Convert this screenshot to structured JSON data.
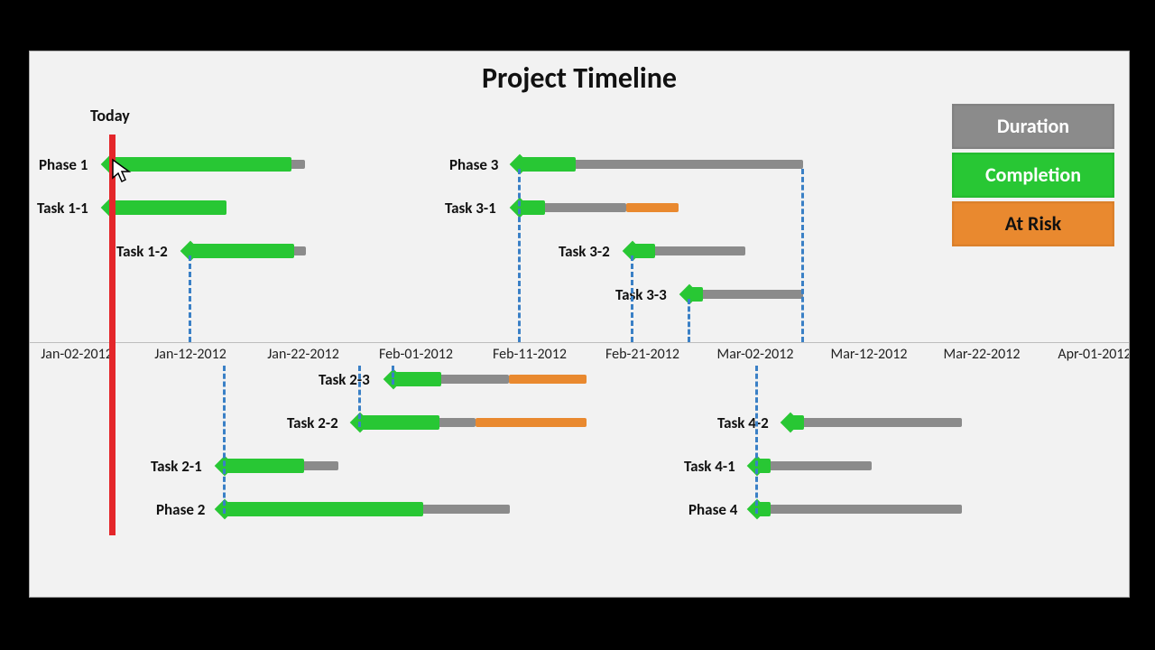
{
  "title": "Project Timeline",
  "today_label": "Today",
  "legend": {
    "duration": "Duration",
    "completion": "Completion",
    "atrisk": "At Risk"
  },
  "colors": {
    "duration": "#8b8b8b",
    "completion": "#28c734",
    "atrisk": "#e9892f",
    "today_line": "#e4262a"
  },
  "axis": {
    "start": "Jan-02-2012",
    "end": "Apr-01-2012",
    "ticks": [
      "Jan-02-2012",
      "Jan-12-2012",
      "Jan-22-2012",
      "Feb-01-2012",
      "Feb-11-2012",
      "Feb-21-2012",
      "Mar-02-2012",
      "Mar-12-2012",
      "Mar-22-2012",
      "Apr-01-2012"
    ]
  },
  "tasks": {
    "phase1": "Phase 1",
    "task11": "Task 1-1",
    "task12": "Task 1-2",
    "phase3": "Phase 3",
    "task31": "Task 3-1",
    "task32": "Task 3-2",
    "task33": "Task 3-3",
    "phase2": "Phase 2",
    "task21": "Task 2-1",
    "task22": "Task 2-2",
    "task23": "Task 2-3",
    "phase4": "Phase 4",
    "task41": "Task 4-1",
    "task42": "Task 4-2"
  },
  "chart_data": {
    "type": "bar",
    "title": "Project Timeline",
    "xlabel": "",
    "ylabel": "",
    "today": "Jan-03-2012",
    "x_range": [
      "Jan-02-2012",
      "Apr-01-2012"
    ],
    "series": [
      {
        "name": "Phase 1",
        "lane": "above",
        "start": "Jan-03-2012",
        "end": "Jan-20-2012",
        "completion_end": "Jan-19-2012",
        "at_risk": false
      },
      {
        "name": "Task 1-1",
        "lane": "above",
        "start": "Jan-03-2012",
        "end": "Jan-13-2012",
        "completion_end": "Jan-13-2012",
        "at_risk": false
      },
      {
        "name": "Task 1-2",
        "lane": "above",
        "start": "Jan-10-2012",
        "end": "Jan-20-2012",
        "completion_end": "Jan-19-2012",
        "at_risk": false
      },
      {
        "name": "Phase 3",
        "lane": "above",
        "start": "Feb-09-2012",
        "end": "Mar-04-2012",
        "completion_end": "Feb-14-2012",
        "at_risk": false
      },
      {
        "name": "Task 3-1",
        "lane": "above",
        "start": "Feb-09-2012",
        "end": "Feb-23-2012",
        "completion_end": "Feb-11-2012",
        "at_risk": true,
        "risk_start": "Feb-20-2012",
        "risk_end": "Feb-23-2012"
      },
      {
        "name": "Task 3-2",
        "lane": "above",
        "start": "Feb-19-2012",
        "end": "Feb-29-2012",
        "completion_end": "Feb-21-2012",
        "at_risk": false
      },
      {
        "name": "Task 3-3",
        "lane": "above",
        "start": "Feb-24-2012",
        "end": "Mar-04-2012",
        "completion_end": "Feb-25-2012",
        "at_risk": false
      },
      {
        "name": "Phase 2",
        "lane": "below",
        "start": "Jan-13-2012",
        "end": "Feb-08-2012",
        "completion_end": "Jan-30-2012",
        "at_risk": false
      },
      {
        "name": "Task 2-1",
        "lane": "below",
        "start": "Jan-13-2012",
        "end": "Jan-23-2012",
        "completion_end": "Jan-20-2012",
        "at_risk": false
      },
      {
        "name": "Task 2-2",
        "lane": "below",
        "start": "Jan-25-2012",
        "end": "Feb-15-2012",
        "completion_end": "Feb-01-2012",
        "at_risk": true,
        "risk_start": "Feb-05-2012",
        "risk_end": "Feb-15-2012"
      },
      {
        "name": "Task 2-3",
        "lane": "below",
        "start": "Jan-28-2012",
        "end": "Feb-15-2012",
        "completion_end": "Feb-02-2012",
        "at_risk": true,
        "risk_start": "Feb-08-2012",
        "risk_end": "Feb-15-2012"
      },
      {
        "name": "Phase 4",
        "lane": "below",
        "start": "Mar-01-2012",
        "end": "Mar-19-2012",
        "completion_end": "Mar-02-2012",
        "at_risk": false
      },
      {
        "name": "Task 4-1",
        "lane": "below",
        "start": "Mar-01-2012",
        "end": "Mar-11-2012",
        "completion_end": "Mar-02-2012",
        "at_risk": false
      },
      {
        "name": "Task 4-2",
        "lane": "below",
        "start": "Mar-03-2012",
        "end": "Mar-19-2012",
        "completion_end": "Mar-05-2012",
        "at_risk": false
      }
    ],
    "dependency_lines": [
      {
        "from": "Task 1-2 start",
        "to": "axis"
      },
      {
        "from": "Phase 2 start",
        "to": "axis"
      },
      {
        "from": "Task 2-2 start",
        "to": "axis"
      },
      {
        "from": "Task 2-3 start",
        "to": "axis"
      },
      {
        "from": "Phase 3 start",
        "to": "axis"
      },
      {
        "from": "Task 3-2 start",
        "to": "axis"
      },
      {
        "from": "Task 3-3 start",
        "to": "axis"
      },
      {
        "from": "Phase 4 start",
        "to": "axis"
      },
      {
        "from": "Task 4-2 start",
        "to": "axis"
      }
    ]
  }
}
